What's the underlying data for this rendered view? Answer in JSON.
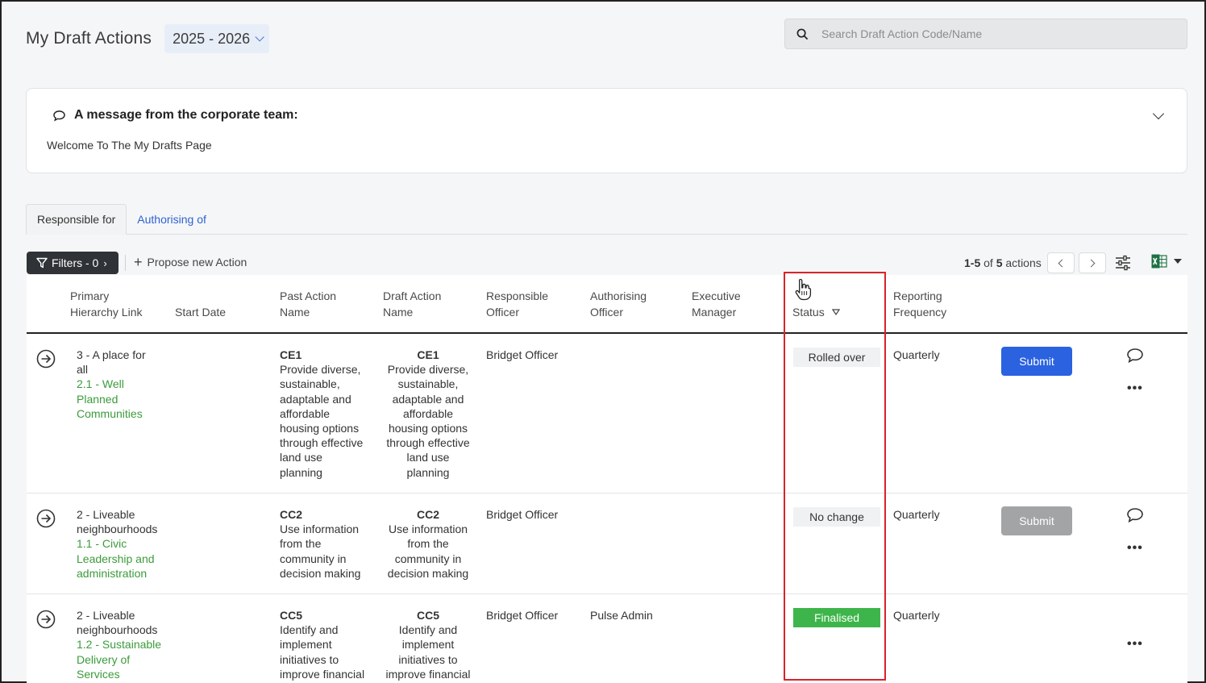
{
  "header": {
    "title": "My Draft Actions",
    "year": "2025 - 2026"
  },
  "search": {
    "placeholder": "Search Draft Action Code/Name"
  },
  "message": {
    "heading": "A message from the corporate team:",
    "body": "Welcome To The My Drafts Page"
  },
  "tabs": [
    {
      "label": "Responsible for"
    },
    {
      "label": "Authorising of"
    }
  ],
  "toolbar": {
    "filters_label": "Filters - 0",
    "propose_label": "Propose new Action",
    "range": "1-5",
    "of_text": "of",
    "total": "5",
    "actions_text": "actions"
  },
  "columns": {
    "primary": [
      "Primary",
      "Hierarchy Link"
    ],
    "start": "Start Date",
    "past": [
      "Past Action",
      "Name"
    ],
    "draft": [
      "Draft Action",
      "Name"
    ],
    "responsible": [
      "Responsible",
      "Officer"
    ],
    "authorising": [
      "Authorising",
      "Officer"
    ],
    "executive": [
      "Executive",
      "Manager"
    ],
    "status": "Status",
    "reporting": [
      "Reporting",
      "Frequency"
    ]
  },
  "rows": [
    {
      "hierarchy": [
        "3 - A place for",
        "all"
      ],
      "hierarchy_link": [
        "2.1 - Well",
        "Planned",
        "Communities"
      ],
      "code": "CE1",
      "past_name": [
        "Provide diverse,",
        "sustainable,",
        "adaptable and",
        "affordable",
        "housing options",
        "through effective",
        "land use",
        "planning"
      ],
      "draft_name": [
        "Provide diverse,",
        "sustainable,",
        "adaptable and",
        "affordable",
        "housing options",
        "through effective",
        "land use",
        "planning"
      ],
      "responsible": "Bridget Officer",
      "authorising": "",
      "status": "Rolled over",
      "reporting": "Quarterly",
      "submit": "Submit"
    },
    {
      "hierarchy": [
        "2 - Liveable",
        "neighbourhoods"
      ],
      "hierarchy_link": [
        "1.1 - Civic",
        "Leadership and",
        "administration"
      ],
      "code": "CC2",
      "past_name": [
        "Use information",
        "from the",
        "community in",
        "decision making"
      ],
      "draft_name": [
        "Use information",
        "from the",
        "community in",
        "decision making"
      ],
      "responsible": "Bridget Officer",
      "authorising": "",
      "status": "No change",
      "reporting": "Quarterly",
      "submit": "Submit"
    },
    {
      "hierarchy": [
        "2 - Liveable",
        "neighbourhoods"
      ],
      "hierarchy_link": [
        "1.2 - Sustainable",
        "Delivery of",
        "Services"
      ],
      "code": "CC5",
      "past_name": [
        "Identify and",
        "implement",
        "initiatives to",
        "improve financial"
      ],
      "draft_name": [
        "Identify and",
        "implement",
        "initiatives to",
        "improve financial"
      ],
      "responsible": "Bridget Officer",
      "authorising": "Pulse Admin",
      "status": "Finalised",
      "reporting": "Quarterly"
    }
  ],
  "colors": {
    "accent": "#2a62e0",
    "link": "#2f62d6",
    "hierarchy_green": "#3b9b3b",
    "finalised": "#3eb54a",
    "highlight": "#d9232a"
  }
}
